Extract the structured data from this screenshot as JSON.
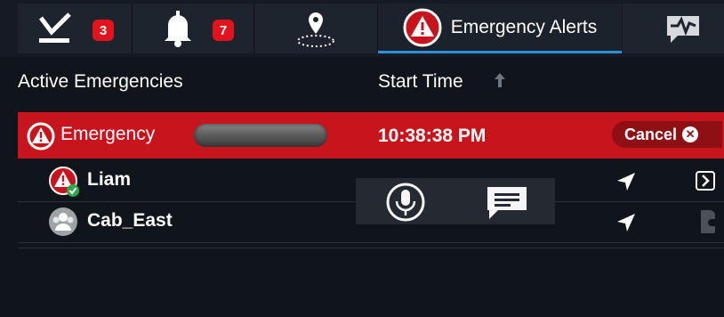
{
  "tabs": [
    {
      "name": "tasks",
      "icon": "checkmark-icon",
      "badge": "3"
    },
    {
      "name": "alerts",
      "icon": "bell-icon",
      "badge": "7"
    },
    {
      "name": "geofence",
      "icon": "map-pin-icon"
    },
    {
      "name": "emergency-alerts",
      "icon": "emergency-alert-icon",
      "label": "Emergency Alerts",
      "active": true
    },
    {
      "name": "vitals",
      "icon": "heartbeat-chat-icon"
    }
  ],
  "columns": {
    "active": "Active Emergencies",
    "start_time": "Start Time",
    "sort_direction": "ascending"
  },
  "emergency": {
    "label": "Emergency",
    "time": "10:38:38 PM",
    "cancel_label": "Cancel"
  },
  "members": [
    {
      "name": "Liam",
      "icon": "user-emergency-icon",
      "status": "acknowledged"
    },
    {
      "name": "Cab_East",
      "icon": "group-icon"
    }
  ],
  "overlay": {
    "buttons": [
      "microphone-icon",
      "message-icon"
    ]
  },
  "colors": {
    "emergency_red": "#c8141c",
    "cancel_red": "#8e0f14",
    "badge_red": "#e3131d",
    "active_tab_underline": "#2f8fd6",
    "background": "#10141b",
    "check_green": "#2ea84a"
  }
}
